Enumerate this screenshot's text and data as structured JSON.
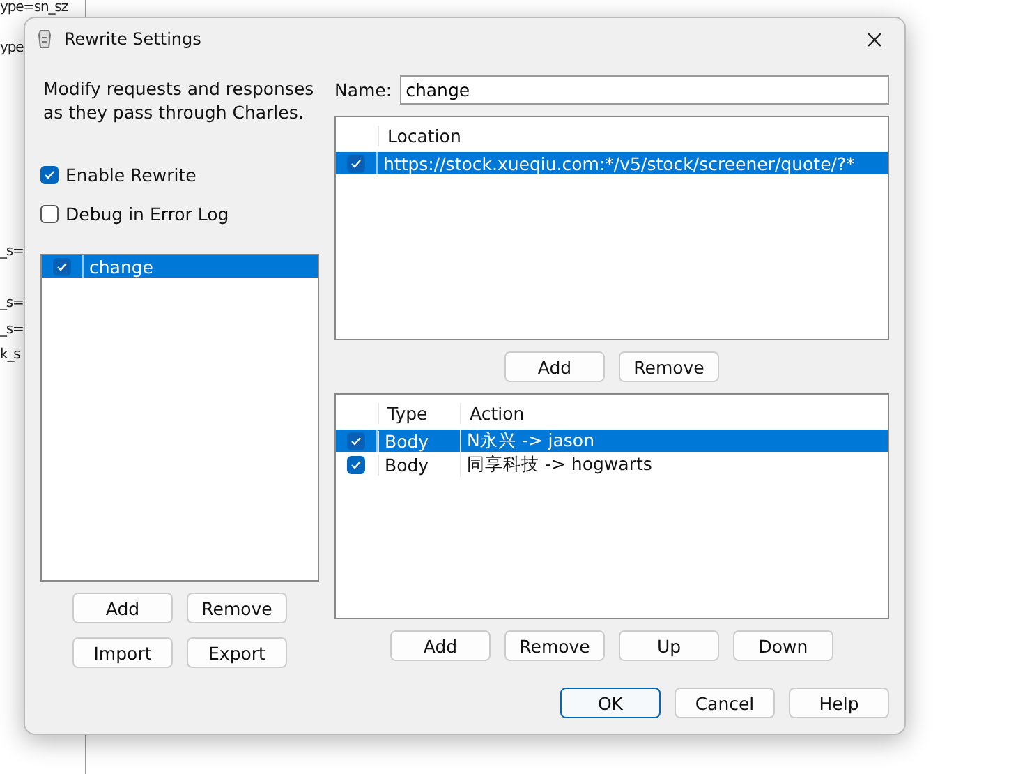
{
  "background": {
    "lines": [
      "ype=sn_sz",
      "ype",
      "_s=",
      "_s=",
      "_s=",
      "k_s"
    ]
  },
  "window": {
    "title": "Rewrite Settings"
  },
  "description": "Modify requests and responses as they pass through Charles.",
  "options": [
    {
      "label": "Enable Rewrite",
      "checked": true
    },
    {
      "label": "Debug in Error Log",
      "checked": false
    }
  ],
  "sets": [
    {
      "name": "change",
      "checked": true,
      "selected": true
    }
  ],
  "set_buttons": [
    "Add",
    "Remove",
    "Import",
    "Export"
  ],
  "name": {
    "label": "Name:",
    "value": "change"
  },
  "locations": {
    "columns": [
      "Location"
    ],
    "rows": [
      {
        "checked": true,
        "selected": true,
        "location": "https://stock.xueqiu.com:*/v5/stock/screener/quote/?*"
      }
    ]
  },
  "location_buttons": [
    "Add",
    "Remove"
  ],
  "rules": {
    "columns": [
      "Type",
      "Action"
    ],
    "rows": [
      {
        "checked": true,
        "selected": true,
        "type": "Body",
        "action": "N永兴 -> jason"
      },
      {
        "checked": true,
        "selected": false,
        "type": "Body",
        "action": "同享科技 -> hogwarts"
      }
    ]
  },
  "rule_buttons": [
    "Add",
    "Remove",
    "Up",
    "Down"
  ],
  "dialog_buttons": [
    {
      "label": "OK",
      "default": true
    },
    {
      "label": "Cancel",
      "default": false
    },
    {
      "label": "Help",
      "default": false
    }
  ]
}
